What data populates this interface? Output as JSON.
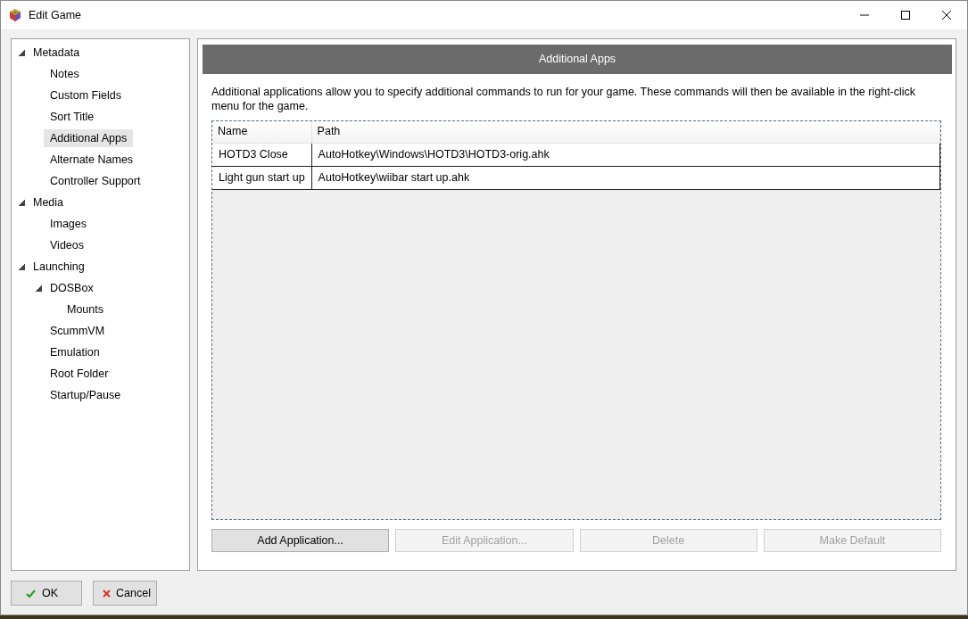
{
  "window": {
    "title": "Edit Game"
  },
  "tree": [
    {
      "label": "Metadata",
      "expanded": true,
      "selected": false,
      "children": [
        {
          "label": "Notes",
          "selected": false
        },
        {
          "label": "Custom Fields",
          "selected": false
        },
        {
          "label": "Sort Title",
          "selected": false
        },
        {
          "label": "Additional Apps",
          "selected": true
        },
        {
          "label": "Alternate Names",
          "selected": false
        },
        {
          "label": "Controller Support",
          "selected": false
        }
      ]
    },
    {
      "label": "Media",
      "expanded": true,
      "selected": false,
      "children": [
        {
          "label": "Images",
          "selected": false
        },
        {
          "label": "Videos",
          "selected": false
        }
      ]
    },
    {
      "label": "Launching",
      "expanded": true,
      "selected": false,
      "children": [
        {
          "label": "DOSBox",
          "expanded": true,
          "selected": false,
          "children": [
            {
              "label": "Mounts",
              "selected": false
            }
          ]
        },
        {
          "label": "ScummVM",
          "selected": false
        },
        {
          "label": "Emulation",
          "selected": false
        },
        {
          "label": "Root Folder",
          "selected": false
        },
        {
          "label": "Startup/Pause",
          "selected": false
        }
      ]
    }
  ],
  "panel": {
    "title": "Additional Apps",
    "description": "Additional applications allow you to specify additional commands to run for your game.  These commands will then be available in the right-click menu for the game."
  },
  "table": {
    "columns": [
      "Name",
      "Path"
    ],
    "rows": [
      {
        "cells": [
          "HOTD3 Close",
          "AutoHotkey\\Windows\\HOTD3\\HOTD3-orig.ahk"
        ]
      },
      {
        "cells": [
          "Light gun start up",
          "AutoHotkey\\wiibar start up.ahk"
        ]
      }
    ]
  },
  "actions": [
    {
      "label": "Add Application...",
      "disabled": false
    },
    {
      "label": "Edit Application...",
      "disabled": true
    },
    {
      "label": "Delete",
      "disabled": true
    },
    {
      "label": "Make Default",
      "disabled": true
    }
  ],
  "footer": [
    {
      "label": "OK",
      "kind": "ok"
    },
    {
      "label": "Cancel",
      "kind": "cancel"
    }
  ]
}
